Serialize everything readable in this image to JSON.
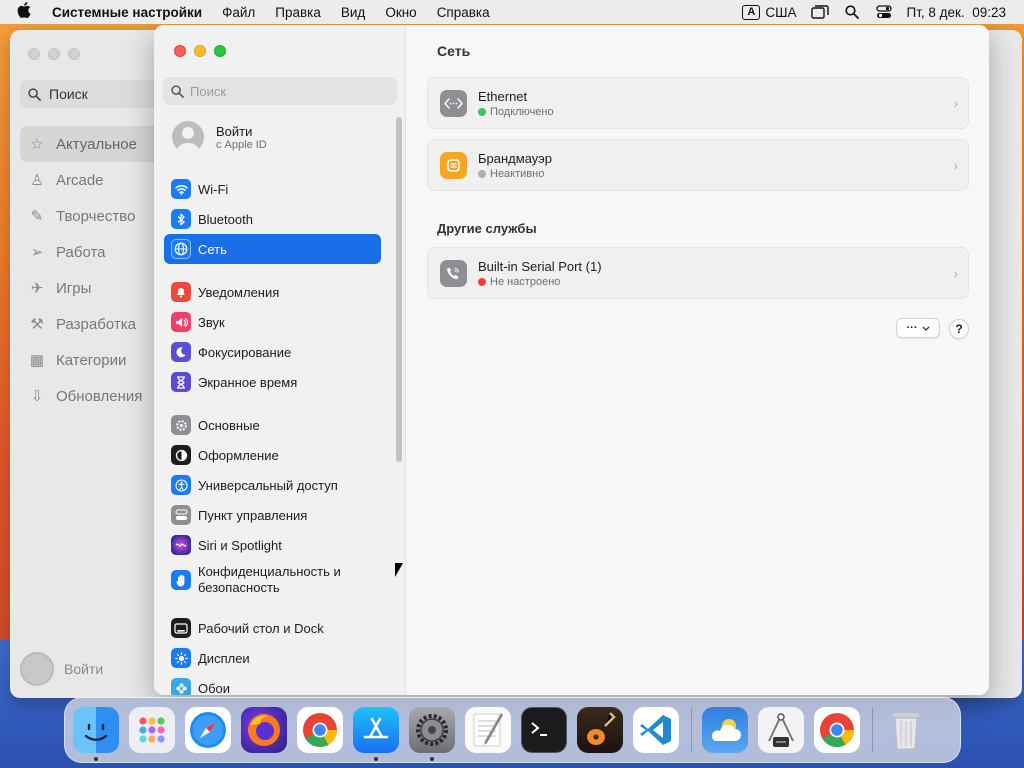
{
  "menubar": {
    "app_name": "Системные настройки",
    "items": [
      "Файл",
      "Правка",
      "Вид",
      "Окно",
      "Справка"
    ],
    "keyboard_badge": "A",
    "input_source": "США",
    "clock": "Пт, 8 дек.  09:23"
  },
  "background_window": {
    "search_label": "Поиск",
    "items": [
      {
        "label": "Актуальное",
        "icon": "star-icon"
      },
      {
        "label": "Arcade",
        "icon": "joystick-icon"
      },
      {
        "label": "Творчество",
        "icon": "brush-icon"
      },
      {
        "label": "Работа",
        "icon": "paperplane-icon"
      },
      {
        "label": "Игры",
        "icon": "rocket-icon"
      },
      {
        "label": "Разработка",
        "icon": "hammer-icon"
      },
      {
        "label": "Категории",
        "icon": "grid-icon"
      },
      {
        "label": "Обновления",
        "icon": "download-icon"
      }
    ],
    "login_label": "Войти"
  },
  "sidebar": {
    "search_placeholder": "Поиск",
    "account": {
      "title": "Войти",
      "subtitle": "с Apple ID"
    },
    "group1": [
      {
        "label": "Wi-Fi",
        "color": "#1a7cf5"
      },
      {
        "label": "Bluetooth",
        "color": "#1a7cf5"
      },
      {
        "label": "Сеть",
        "color": "#1a7cf5"
      }
    ],
    "group2": [
      {
        "label": "Уведомления",
        "color": "#f0463c"
      },
      {
        "label": "Звук",
        "color": "#ee3e6a"
      },
      {
        "label": "Фокусирование",
        "color": "#5b4fd6"
      },
      {
        "label": "Экранное время",
        "color": "#5a4bd2"
      }
    ],
    "group3": [
      {
        "label": "Основные",
        "color": "#8e8e93"
      },
      {
        "label": "Оформление",
        "color": "#1d1d1f"
      },
      {
        "label": "Универсальный доступ",
        "color": "#1a7cf5"
      },
      {
        "label": "Пункт управления",
        "color": "#8e8e93"
      },
      {
        "label": "Siri и Spotlight",
        "color": "#7b3fcf"
      },
      {
        "label": "Конфиденциальность и безопасность",
        "color": "#1a7cf5"
      }
    ],
    "group4": [
      {
        "label": "Рабочий стол и Dock",
        "color": "#1d1d1f"
      },
      {
        "label": "Дисплеи",
        "color": "#1a7cf5"
      },
      {
        "label": "Обои",
        "color": "#35a7e6"
      }
    ]
  },
  "content": {
    "title": "Сеть",
    "services": [
      {
        "name": "Ethernet",
        "status": "Подключено",
        "status_color": "#34c759",
        "icon_color": "#8e8e93"
      },
      {
        "name": "Брандмауэр",
        "status": "Неактивно",
        "status_color": "#aeaeb2",
        "icon_color": "#f5a623"
      }
    ],
    "other_title": "Другие службы",
    "other_services": [
      {
        "name": "Built-in Serial Port (1)",
        "status": "Не настроено",
        "status_color": "#ff3b30",
        "icon_color": "#8e8e93"
      }
    ],
    "more_button": "···",
    "help_button": "?"
  },
  "dock": {
    "apps": [
      "Finder",
      "Launchpad",
      "Safari",
      "Firefox",
      "Chrome",
      "App Store",
      "Системные настройки",
      "TextEdit",
      "Терминал",
      "GarageBand",
      "Visual Studio Code",
      "Погода",
      "Утилита",
      "Chrome",
      "Корзина"
    ]
  }
}
